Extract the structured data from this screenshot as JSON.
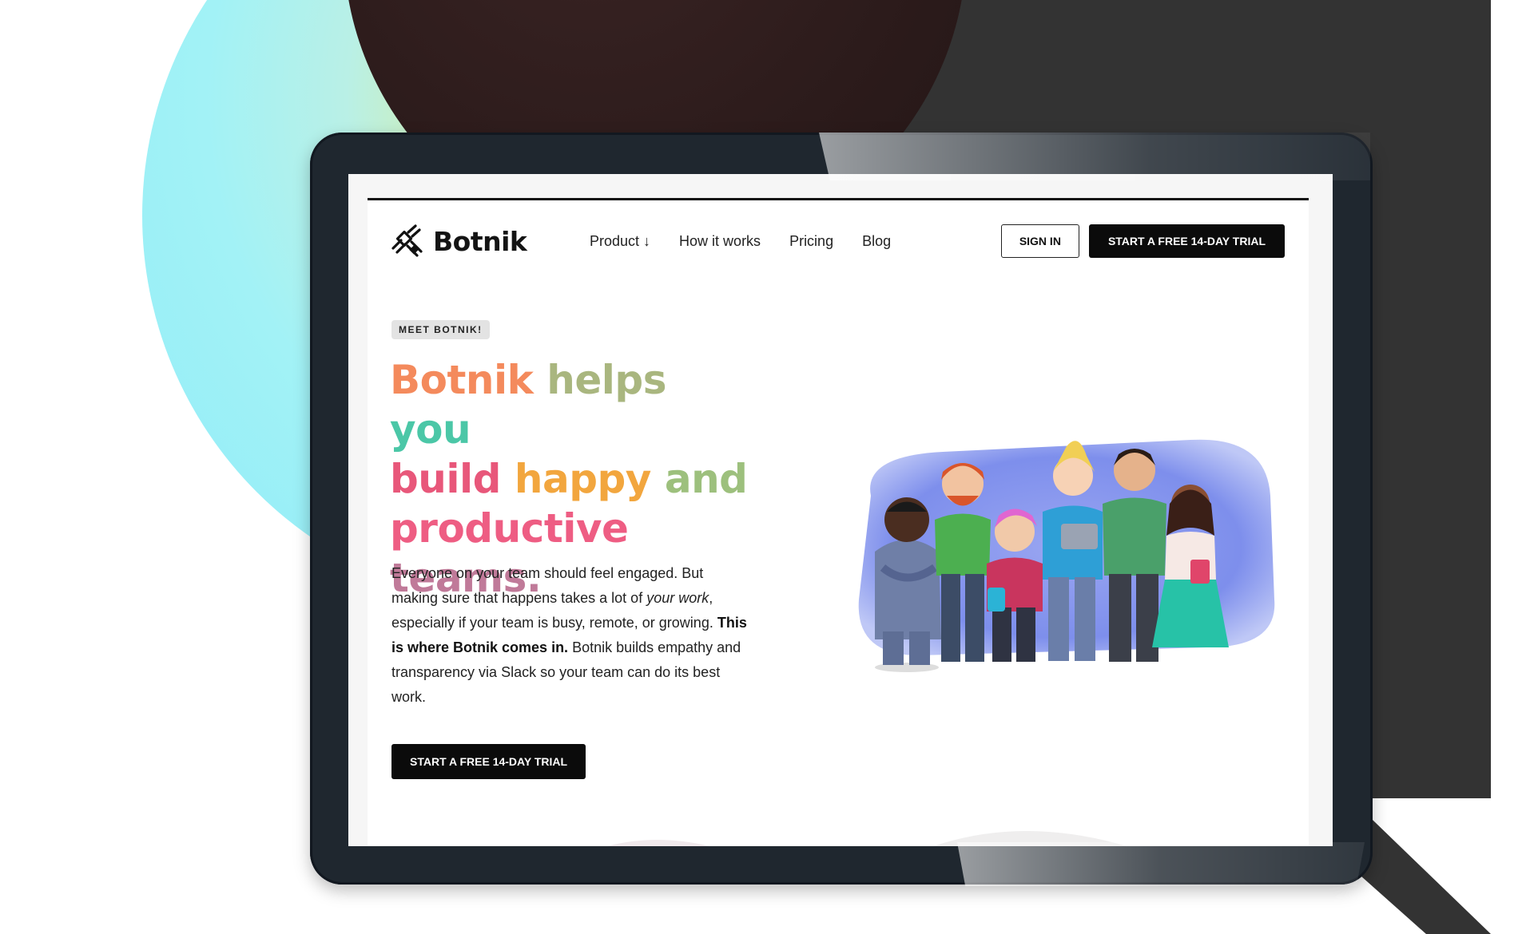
{
  "brand": {
    "name": "Botnik"
  },
  "nav": {
    "links": [
      {
        "label": "Product ↓"
      },
      {
        "label": "How it works"
      },
      {
        "label": "Pricing"
      },
      {
        "label": "Blog"
      }
    ],
    "sign_in": "SIGN IN",
    "trial": "START A FREE 14-DAY TRIAL"
  },
  "hero": {
    "badge": "MEET BOTNIK!",
    "headline_words": [
      "Botnik",
      "helps",
      "you",
      "build",
      "happy",
      "and",
      "productive",
      "teams."
    ],
    "body": {
      "p1": "Everyone on your team should feel engaged. But making sure that happens takes a lot of ",
      "p1_italic": "your work",
      "p2": ", especially if your team is busy, remote, or growing. ",
      "p2_bold": "This is where Botnik comes in.",
      "p3": " Botnik builds empathy and transparency via Slack so your team can do its best work."
    },
    "cta": "START A FREE 14-DAY TRIAL"
  },
  "colors": {
    "dark_bg": "#333333",
    "device": "#1f272f",
    "button": "#0b0b0b",
    "gradient": [
      "#f48a5c",
      "#a9b67f",
      "#4bc7a7",
      "#e8577a",
      "#f2a63e",
      "#c07a99"
    ]
  },
  "icons": {
    "logo": "botnik-satellite-icon",
    "illustration": "team-people-illustration"
  }
}
